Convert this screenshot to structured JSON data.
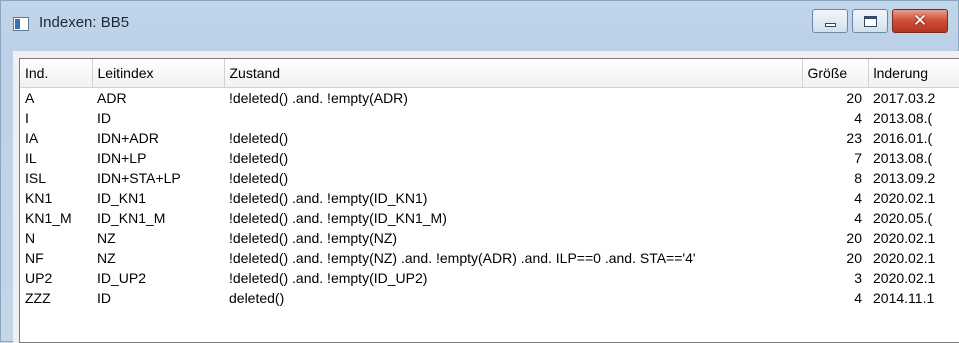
{
  "window": {
    "title": "Indexen: BB5",
    "minimize_icon": "minimize-icon",
    "maximize_icon": "maximize-icon",
    "close_icon": "close-icon",
    "close_glyph": "✕"
  },
  "table": {
    "columns": [
      "Ind.",
      "Leitindex",
      "Zustand",
      "Größe",
      "lnderung"
    ],
    "rows": [
      {
        "ind": "A",
        "leitindex": "ADR",
        "zustand": "!deleted() .and. !empty(ADR)",
        "groesse": "20",
        "aenderung": "2017.03.2"
      },
      {
        "ind": "I",
        "leitindex": "ID",
        "zustand": "",
        "groesse": "4",
        "aenderung": "2013.08.("
      },
      {
        "ind": "IA",
        "leitindex": "IDN+ADR",
        "zustand": "!deleted()",
        "groesse": "23",
        "aenderung": "2016.01.("
      },
      {
        "ind": "IL",
        "leitindex": "IDN+LP",
        "zustand": "!deleted()",
        "groesse": "7",
        "aenderung": "2013.08.("
      },
      {
        "ind": "ISL",
        "leitindex": "IDN+STA+LP",
        "zustand": "!deleted()",
        "groesse": "8",
        "aenderung": "2013.09.2"
      },
      {
        "ind": "KN1",
        "leitindex": "ID_KN1",
        "zustand": "!deleted() .and. !empty(ID_KN1)",
        "groesse": "4",
        "aenderung": "2020.02.1"
      },
      {
        "ind": "KN1_M",
        "leitindex": "ID_KN1_M",
        "zustand": "!deleted() .and. !empty(ID_KN1_M)",
        "groesse": "4",
        "aenderung": "2020.05.("
      },
      {
        "ind": "N",
        "leitindex": "NZ",
        "zustand": "!deleted() .and. !empty(NZ)",
        "groesse": "20",
        "aenderung": "2020.02.1"
      },
      {
        "ind": "NF",
        "leitindex": "NZ",
        "zustand": "!deleted() .and. !empty(NZ) .and. !empty(ADR) .and. ILP==0 .and. STA=='4'",
        "groesse": "20",
        "aenderung": "2020.02.1"
      },
      {
        "ind": "UP2",
        "leitindex": "ID_UP2",
        "zustand": "!deleted() .and. !empty(ID_UP2)",
        "groesse": "3",
        "aenderung": "2020.02.1"
      },
      {
        "ind": "ZZZ",
        "leitindex": "ID",
        "zustand": "deleted()",
        "groesse": "4",
        "aenderung": "2014.11.1"
      }
    ]
  }
}
